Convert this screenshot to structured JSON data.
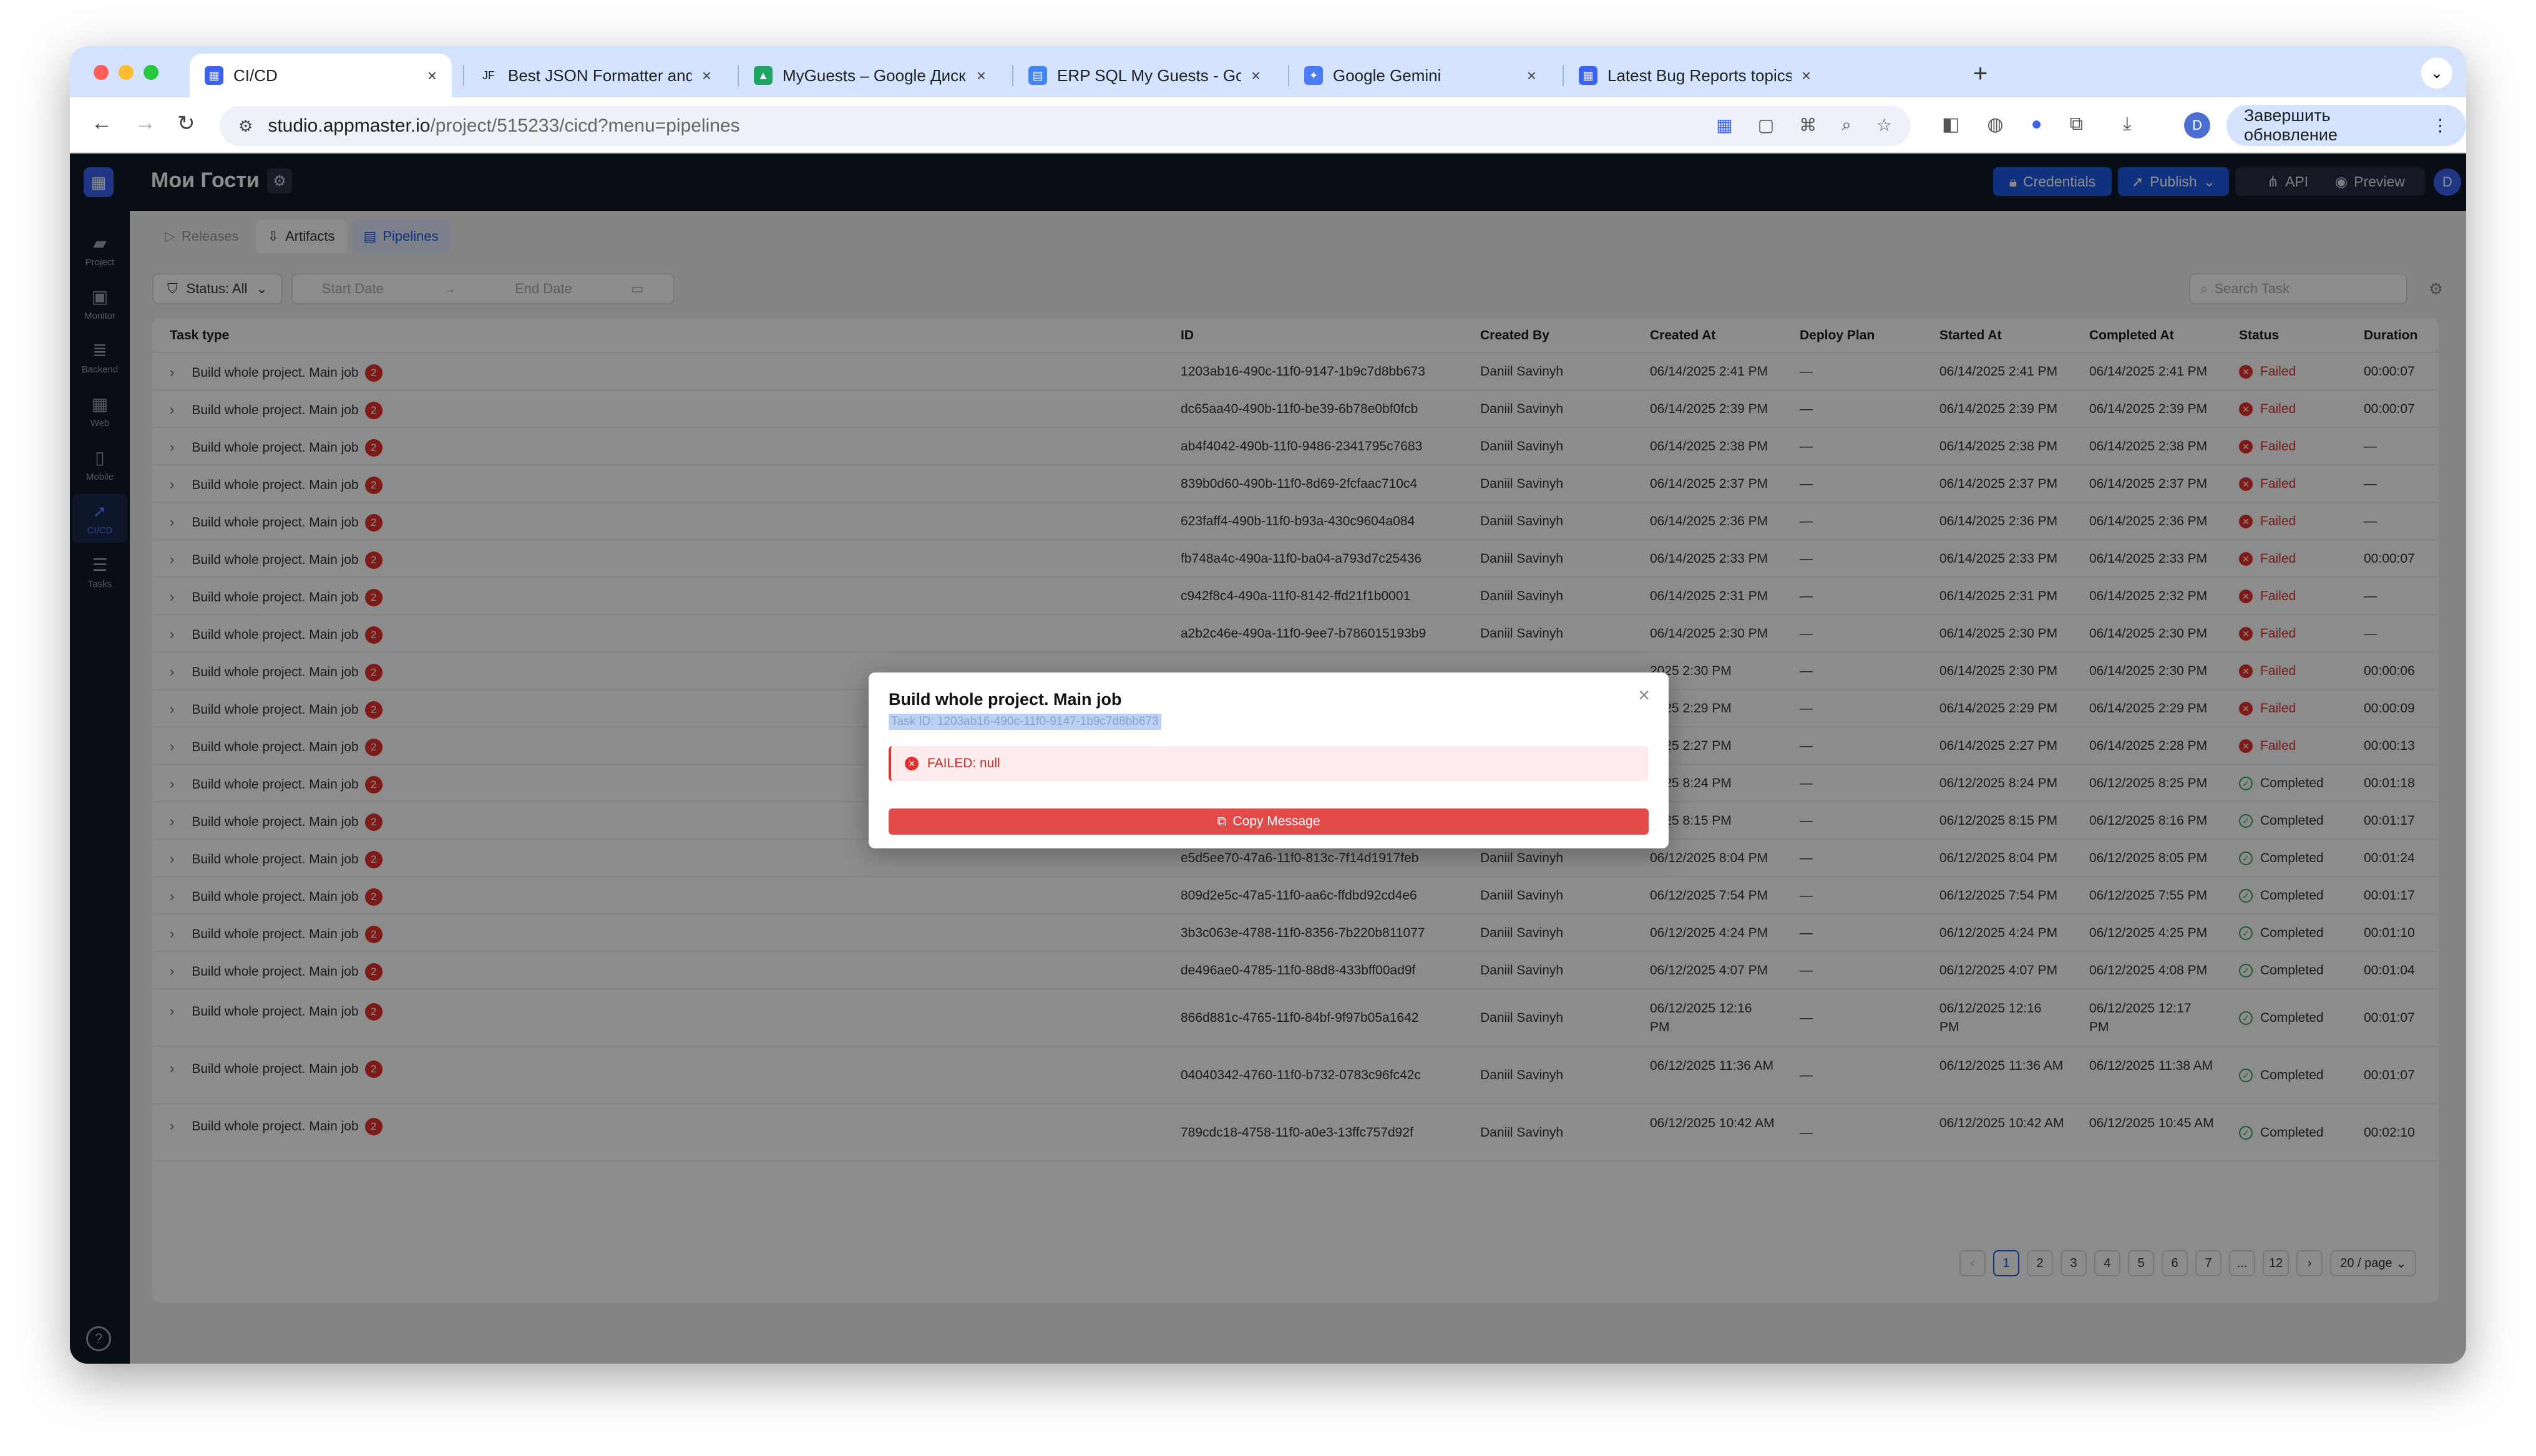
{
  "browser": {
    "tabs": [
      {
        "label": "CI/CD",
        "icon": "appmaster-icon",
        "color": "#3b63f0"
      },
      {
        "label": "Best JSON Formatter and JSON",
        "icon": "jf-icon",
        "color": "#222222"
      },
      {
        "label": "MyGuests – Google Диск",
        "icon": "google-drive-icon",
        "color": "#1fa463"
      },
      {
        "label": "ERP SQL My Guests - Google",
        "icon": "google-docs-icon",
        "color": "#4285f4"
      },
      {
        "label": "Google Gemini",
        "icon": "gemini-icon",
        "color": "#4b7cf5"
      },
      {
        "label": "Latest Bug Reports topics - A",
        "icon": "appmaster-icon",
        "color": "#3b63f0"
      }
    ],
    "url_host": "studio.appmaster.io",
    "url_path": "/project/515233/cicd?menu=pipelines",
    "profile_initial": "D",
    "update_button": "Завершить обновление"
  },
  "app": {
    "project_title": "Мои Гости",
    "header_buttons": {
      "credentials": "Credentials",
      "publish": "Publish",
      "api": "API",
      "preview": "Preview"
    },
    "user_initial": "D",
    "sidebar": [
      {
        "label": "Project",
        "icon": "folder-icon"
      },
      {
        "label": "Monitor",
        "icon": "monitor-icon"
      },
      {
        "label": "Backend",
        "icon": "database-icon"
      },
      {
        "label": "Web",
        "icon": "browser-icon"
      },
      {
        "label": "Mobile",
        "icon": "mobile-icon"
      },
      {
        "label": "CI/CD",
        "icon": "rocket-icon",
        "active": true
      },
      {
        "label": "Tasks",
        "icon": "tasks-icon"
      }
    ],
    "subtabs": {
      "releases": "Releases",
      "artifacts": "Artifacts",
      "pipelines": "Pipelines"
    },
    "filters": {
      "status": "Status: All",
      "start_date": "Start Date",
      "end_date": "End Date",
      "search_placeholder": "Search Task"
    }
  },
  "table": {
    "columns": {
      "task_type": "Task type",
      "id": "ID",
      "created_by": "Created By",
      "created_at": "Created At",
      "deploy_plan": "Deploy Plan",
      "started_at": "Started At",
      "completed_at": "Completed At",
      "status": "Status",
      "duration": "Duration"
    },
    "rows": [
      {
        "task": "Build whole project. Main job",
        "badge": "2",
        "id": "1203ab16-490c-11f0-9147-1b9c7d8bb673",
        "by": "Daniil Savinyh",
        "created": "06/14/2025 2:41 PM",
        "plan": "—",
        "started": "06/14/2025 2:41 PM",
        "completed": "06/14/2025 2:41 PM",
        "status": "Failed",
        "duration": "00:00:07"
      },
      {
        "task": "Build whole project. Main job",
        "badge": "2",
        "id": "dc65aa40-490b-11f0-be39-6b78e0bf0fcb",
        "by": "Daniil Savinyh",
        "created": "06/14/2025 2:39 PM",
        "plan": "—",
        "started": "06/14/2025 2:39 PM",
        "completed": "06/14/2025 2:39 PM",
        "status": "Failed",
        "duration": "00:00:07"
      },
      {
        "task": "Build whole project. Main job",
        "badge": "2",
        "id": "ab4f4042-490b-11f0-9486-2341795c7683",
        "by": "Daniil Savinyh",
        "created": "06/14/2025 2:38 PM",
        "plan": "—",
        "started": "06/14/2025 2:38 PM",
        "completed": "06/14/2025 2:38 PM",
        "status": "Failed",
        "duration": "—"
      },
      {
        "task": "Build whole project. Main job",
        "badge": "2",
        "id": "839b0d60-490b-11f0-8d69-2fcfaac710c4",
        "by": "Daniil Savinyh",
        "created": "06/14/2025 2:37 PM",
        "plan": "—",
        "started": "06/14/2025 2:37 PM",
        "completed": "06/14/2025 2:37 PM",
        "status": "Failed",
        "duration": "—"
      },
      {
        "task": "Build whole project. Main job",
        "badge": "2",
        "id": "623faff4-490b-11f0-b93a-430c9604a084",
        "by": "Daniil Savinyh",
        "created": "06/14/2025 2:36 PM",
        "plan": "—",
        "started": "06/14/2025 2:36 PM",
        "completed": "06/14/2025 2:36 PM",
        "status": "Failed",
        "duration": "—"
      },
      {
        "task": "Build whole project. Main job",
        "badge": "2",
        "id": "fb748a4c-490a-11f0-ba04-a793d7c25436",
        "by": "Daniil Savinyh",
        "created": "06/14/2025 2:33 PM",
        "plan": "—",
        "started": "06/14/2025 2:33 PM",
        "completed": "06/14/2025 2:33 PM",
        "status": "Failed",
        "duration": "00:00:07"
      },
      {
        "task": "Build whole project. Main job",
        "badge": "2",
        "id": "c942f8c4-490a-11f0-8142-ffd21f1b0001",
        "by": "Daniil Savinyh",
        "created": "06/14/2025 2:31 PM",
        "plan": "—",
        "started": "06/14/2025 2:31 PM",
        "completed": "06/14/2025 2:32 PM",
        "status": "Failed",
        "duration": "—"
      },
      {
        "task": "Build whole project. Main job",
        "badge": "2",
        "id": "a2b2c46e-490a-11f0-9ee7-b786015193b9",
        "by": "Daniil Savinyh",
        "created": "06/14/2025 2:30 PM",
        "plan": "—",
        "started": "06/14/2025 2:30 PM",
        "completed": "06/14/2025 2:30 PM",
        "status": "Failed",
        "duration": "—"
      },
      {
        "task": "Build whole project. Main job",
        "badge": "2",
        "id": "",
        "by": "",
        "created": "2025 2:30 PM",
        "plan": "—",
        "started": "06/14/2025 2:30 PM",
        "completed": "06/14/2025 2:30 PM",
        "status": "Failed",
        "duration": "00:00:06"
      },
      {
        "task": "Build whole project. Main job",
        "badge": "2",
        "id": "",
        "by": "",
        "created": "2025 2:29 PM",
        "plan": "—",
        "started": "06/14/2025 2:29 PM",
        "completed": "06/14/2025 2:29 PM",
        "status": "Failed",
        "duration": "00:00:09"
      },
      {
        "task": "Build whole project. Main job",
        "badge": "2",
        "id": "",
        "by": "",
        "created": "2025 2:27 PM",
        "plan": "—",
        "started": "06/14/2025 2:27 PM",
        "completed": "06/14/2025 2:28 PM",
        "status": "Failed",
        "duration": "00:00:13"
      },
      {
        "task": "Build whole project. Main job",
        "badge": "2",
        "id": "",
        "by": "",
        "created": "2025 8:24 PM",
        "plan": "—",
        "started": "06/12/2025 8:24 PM",
        "completed": "06/12/2025 8:25 PM",
        "status": "Completed",
        "duration": "00:01:18"
      },
      {
        "task": "Build whole project. Main job",
        "badge": "2",
        "id": "",
        "by": "",
        "created": "2025 8:15 PM",
        "plan": "—",
        "started": "06/12/2025 8:15 PM",
        "completed": "06/12/2025 8:16 PM",
        "status": "Completed",
        "duration": "00:01:17"
      },
      {
        "task": "Build whole project. Main job",
        "badge": "2",
        "id": "e5d5ee70-47a6-11f0-813c-7f14d1917feb",
        "by": "Daniil Savinyh",
        "created": "06/12/2025 8:04 PM",
        "plan": "—",
        "started": "06/12/2025 8:04 PM",
        "completed": "06/12/2025 8:05 PM",
        "status": "Completed",
        "duration": "00:01:24"
      },
      {
        "task": "Build whole project. Main job",
        "badge": "2",
        "id": "809d2e5c-47a5-11f0-aa6c-ffdbd92cd4e6",
        "by": "Daniil Savinyh",
        "created": "06/12/2025 7:54 PM",
        "plan": "—",
        "started": "06/12/2025 7:54 PM",
        "completed": "06/12/2025 7:55 PM",
        "status": "Completed",
        "duration": "00:01:17"
      },
      {
        "task": "Build whole project. Main job",
        "badge": "2",
        "id": "3b3c063e-4788-11f0-8356-7b220b811077",
        "by": "Daniil Savinyh",
        "created": "06/12/2025 4:24 PM",
        "plan": "—",
        "started": "06/12/2025 4:24 PM",
        "completed": "06/12/2025 4:25 PM",
        "status": "Completed",
        "duration": "00:01:10"
      },
      {
        "task": "Build whole project. Main job",
        "badge": "2",
        "id": "de496ae0-4785-11f0-88d8-433bff00ad9f",
        "by": "Daniil Savinyh",
        "created": "06/12/2025 4:07 PM",
        "plan": "—",
        "started": "06/12/2025 4:07 PM",
        "completed": "06/12/2025 4:08 PM",
        "status": "Completed",
        "duration": "00:01:04"
      },
      {
        "task": "Build whole project. Main job",
        "badge": "2",
        "id": "866d881c-4765-11f0-84bf-9f97b05a1642",
        "by": "Daniil Savinyh",
        "created": "06/12/2025 12:16 PM",
        "plan": "—",
        "started": "06/12/2025 12:16 PM",
        "completed": "06/12/2025 12:17 PM",
        "status": "Completed",
        "duration": "00:01:07"
      },
      {
        "task": "Build whole project. Main job",
        "badge": "2",
        "id": "04040342-4760-11f0-b732-0783c96fc42c",
        "by": "Daniil Savinyh",
        "created": "06/12/2025 11:36 AM",
        "plan": "—",
        "started": "06/12/2025 11:36 AM",
        "completed": "06/12/2025 11:38 AM",
        "status": "Completed",
        "duration": "00:01:07"
      },
      {
        "task": "Build whole project. Main job",
        "badge": "2",
        "id": "789cdc18-4758-11f0-a0e3-13ffc757d92f",
        "by": "Daniil Savinyh",
        "created": "06/12/2025 10:42 AM",
        "plan": "—",
        "started": "06/12/2025 10:42 AM",
        "completed": "06/12/2025 10:45 AM",
        "status": "Completed",
        "duration": "00:02:10"
      }
    ]
  },
  "pagination": {
    "pages": [
      "1",
      "2",
      "3",
      "4",
      "5",
      "6",
      "7",
      "...",
      "12"
    ],
    "current": "1",
    "page_size": "20 / page"
  },
  "modal": {
    "title": "Build whole project. Main job",
    "task_id": "Task ID: 1203ab16-490c-11f0-9147-1b9c7d8bb673",
    "alert": "FAILED: null",
    "copy_button": "Copy Message"
  },
  "colors": {
    "failed": "#e5302c",
    "completed": "#34a853",
    "primary": "#1e5ae6",
    "header_bg": "#101828"
  }
}
